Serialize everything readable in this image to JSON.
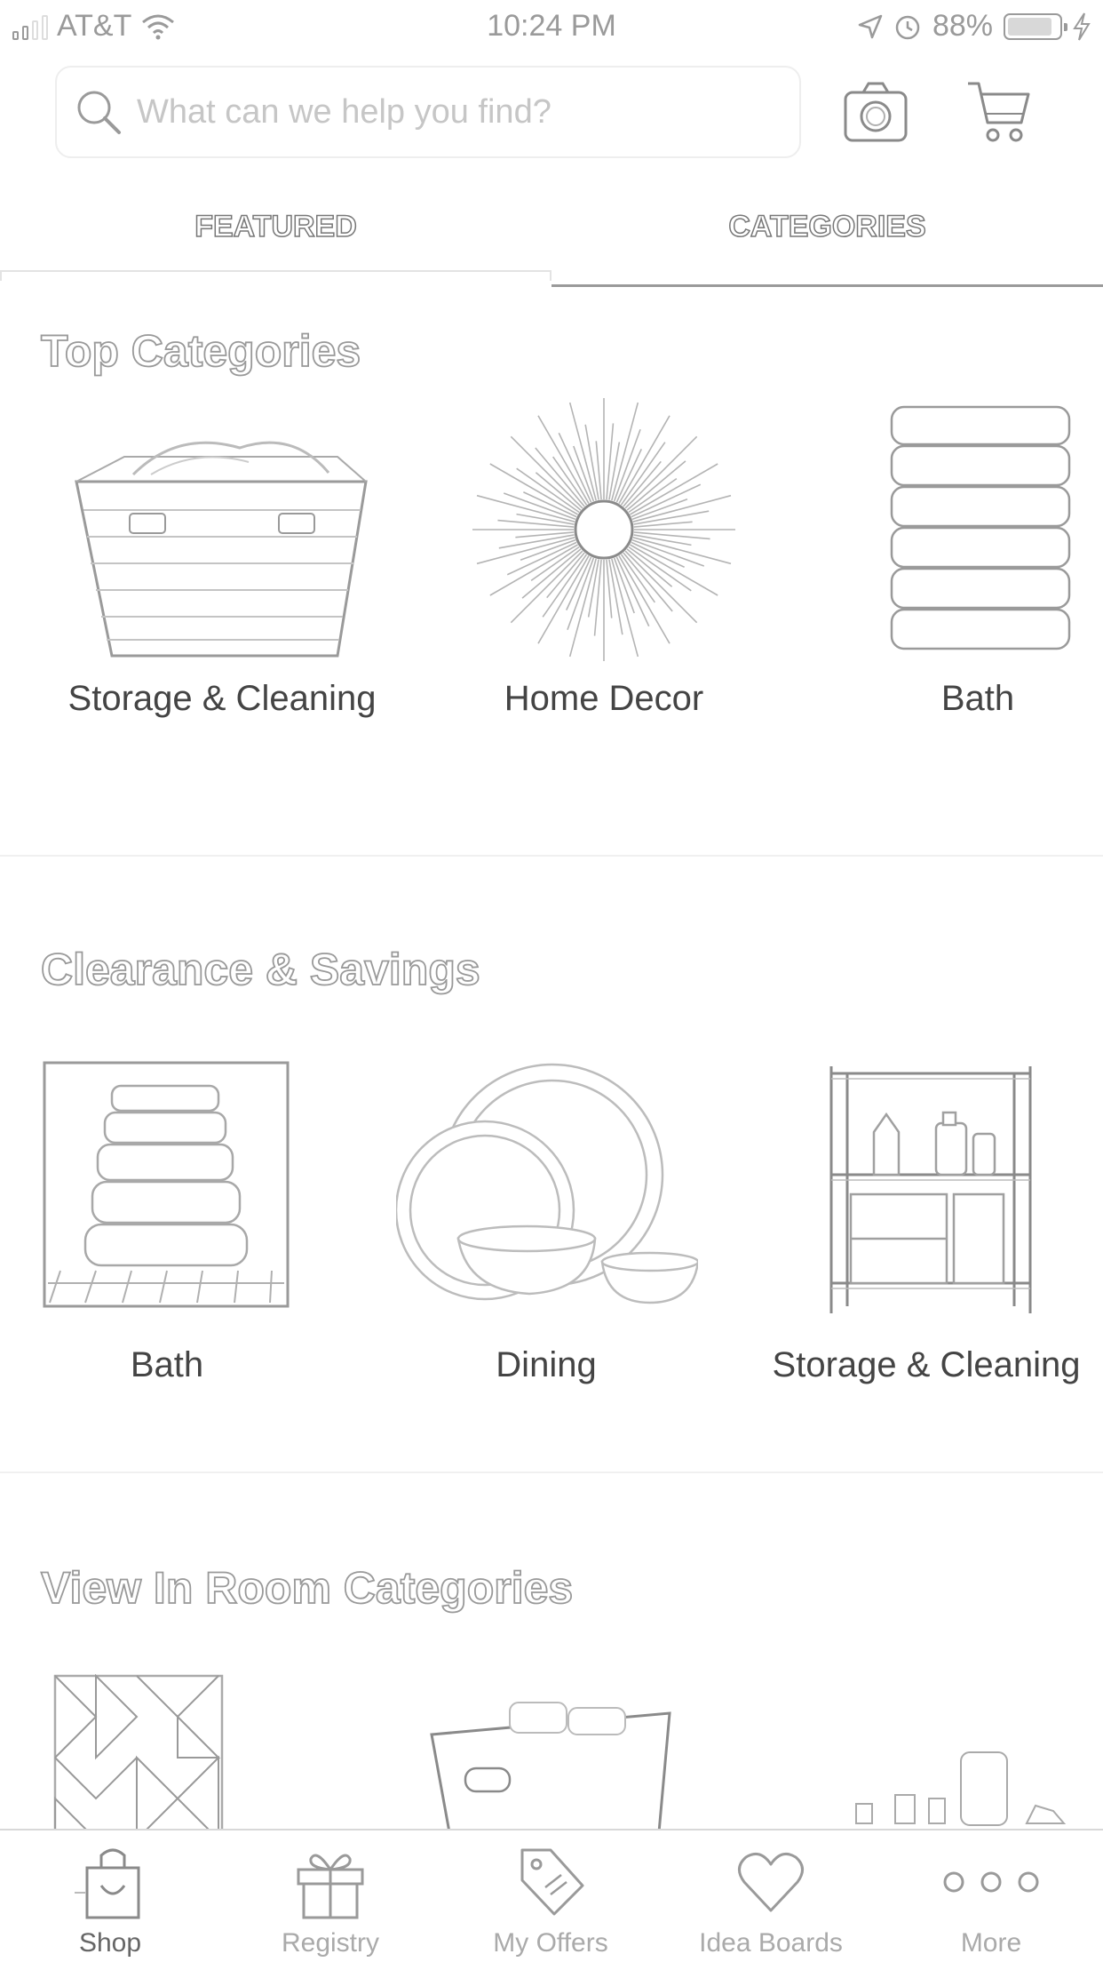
{
  "status_bar": {
    "carrier": "AT&T",
    "time": "10:24 PM",
    "battery_percent": "88%",
    "battery_level": 0.88
  },
  "search": {
    "placeholder": "What can we help you find?"
  },
  "tabs": [
    {
      "label": "FEATURED",
      "selected": true
    },
    {
      "label": "CATEGORIES",
      "selected": false
    }
  ],
  "sections": {
    "top_categories": {
      "title": "Top Categories",
      "items": [
        {
          "label": "Storage & Cleaning",
          "icon": "basket-image"
        },
        {
          "label": "Home Decor",
          "icon": "sunburst-mirror-image"
        },
        {
          "label": "Bath",
          "icon": "towel-stack-image"
        }
      ]
    },
    "clearance": {
      "title": "Clearance & Savings",
      "items": [
        {
          "label": "Bath",
          "icon": "towels-image"
        },
        {
          "label": "Dining",
          "icon": "dinnerware-image"
        },
        {
          "label": "Storage & Cleaning",
          "icon": "shelf-image"
        }
      ]
    },
    "view_in_room": {
      "title": "View In Room Categories",
      "items": [
        {
          "icon": "geometric-art-image"
        },
        {
          "icon": "storage-bin-image"
        },
        {
          "icon": "decor-accessories-image"
        }
      ]
    }
  },
  "bottom_nav": [
    {
      "label": "Shop",
      "icon": "shopping-bag-icon",
      "active": true
    },
    {
      "label": "Registry",
      "icon": "gift-icon",
      "active": false
    },
    {
      "label": "My Offers",
      "icon": "tag-icon",
      "active": false
    },
    {
      "label": "Idea Boards",
      "icon": "heart-icon",
      "active": false
    },
    {
      "label": "More",
      "icon": "more-dots-icon",
      "active": false
    }
  ]
}
